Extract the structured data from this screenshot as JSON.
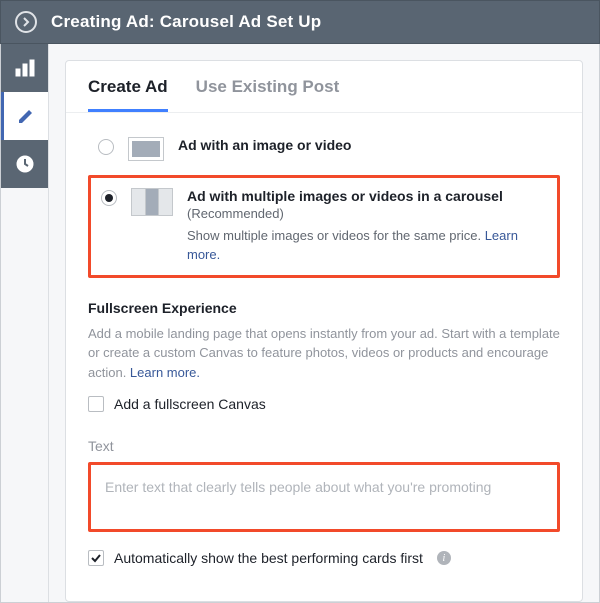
{
  "header": {
    "title": "Creating Ad: Carousel Ad Set Up"
  },
  "tabs": {
    "create": "Create Ad",
    "existing": "Use Existing Post"
  },
  "options": {
    "single": {
      "title": "Ad with an image or video"
    },
    "carousel": {
      "title": "Ad with multiple images or videos in a carousel",
      "sub": "(Recommended)",
      "desc": "Show multiple images or videos for the same price. ",
      "learn": "Learn more."
    }
  },
  "fullscreen": {
    "heading": "Fullscreen Experience",
    "desc": "Add a mobile landing page that opens instantly from your ad. Start with a template or create a custom Canvas to feature photos, videos or products and encourage action. ",
    "learn": "Learn more.",
    "checkbox": "Add a fullscreen Canvas"
  },
  "text": {
    "label": "Text",
    "placeholder": "Enter text that clearly tells people about what you're promoting"
  },
  "auto": {
    "label": "Automatically show the best performing cards first"
  }
}
